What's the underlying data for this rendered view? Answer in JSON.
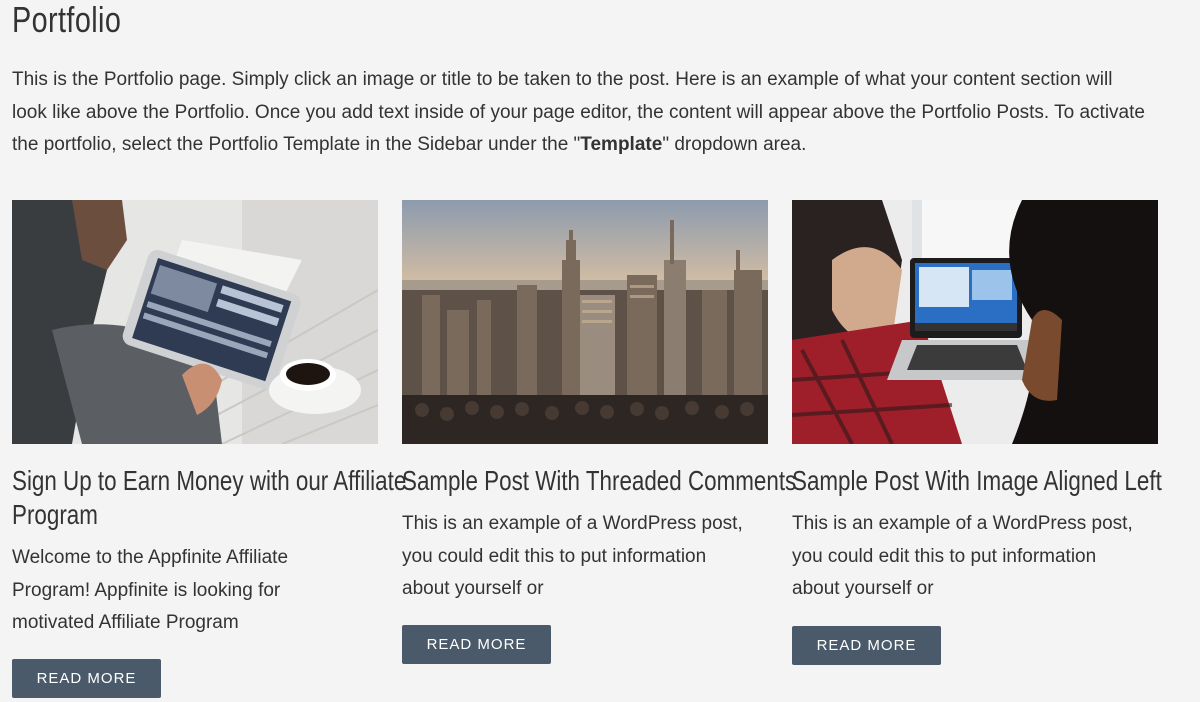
{
  "page": {
    "title": "Portfolio",
    "intro_lines": [
      "This is the Portfolio page. Simply click an image or title to be taken to the post. Here is an example of what your content section will",
      "look like above the Portfolio. Once you add text inside of your page editor, the content will appear above the Portfolio Posts. To activate",
      "the portfolio, select the Portfolio Template in the Sidebar under the \""
    ],
    "intro_bold": "Template",
    "intro_tail": "\" dropdown area."
  },
  "colors": {
    "background": "#f4f4f4",
    "text": "#333333",
    "button": "#4a5a6a",
    "button_text": "#ffffff"
  },
  "posts": [
    {
      "title_lines": [
        "Sign Up to Earn Money with our Affiliate",
        "Program"
      ],
      "excerpt_lines": [
        "Welcome to the Appfinite Affiliate",
        "Program! Appfinite is looking for",
        "motivated Affiliate Program"
      ],
      "button_label": "READ MORE",
      "image_icon": "tablet-coffee-photo"
    },
    {
      "title_lines": [
        "Sample Post With Threaded Comments"
      ],
      "excerpt_lines": [
        "This is an example of a WordPress post,",
        "you could edit this to put information",
        "about yourself or"
      ],
      "button_label": "READ MORE",
      "image_icon": "city-skyline-photo"
    },
    {
      "title_lines": [
        "Sample Post With Image Aligned Left"
      ],
      "excerpt_lines": [
        "This is an example of a WordPress post,",
        "you could edit this to put information",
        "about yourself or"
      ],
      "button_label": "READ MORE",
      "image_icon": "laptop-women-photo"
    }
  ]
}
